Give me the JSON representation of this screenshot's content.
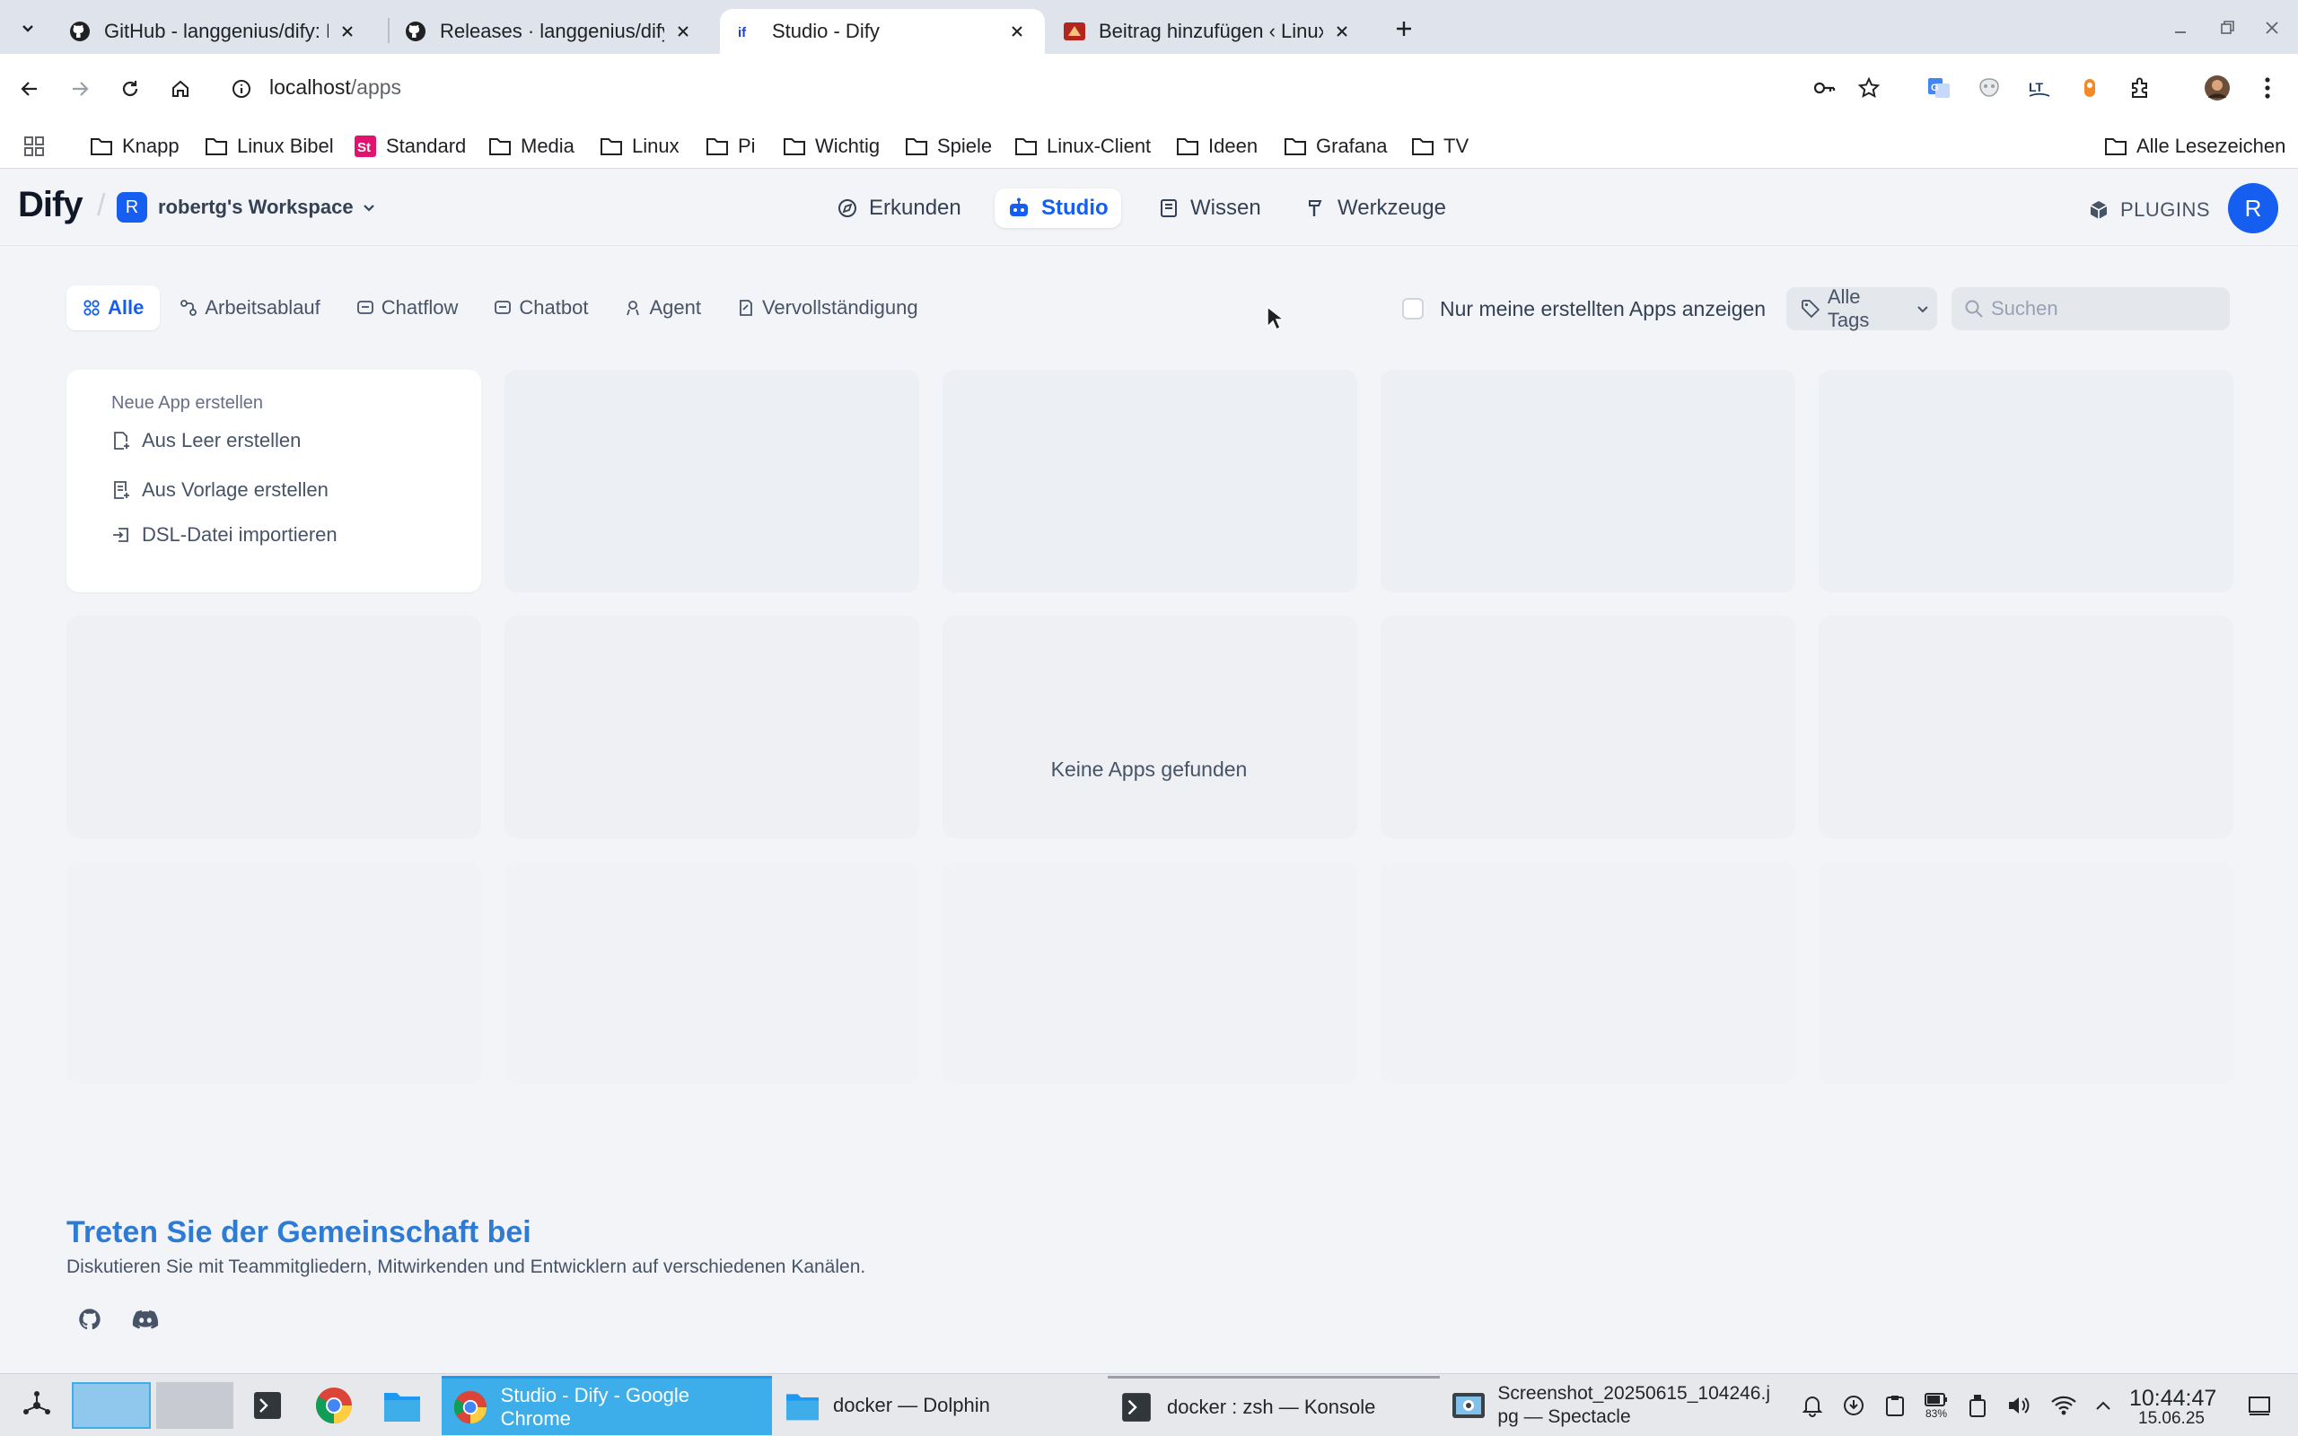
{
  "browser": {
    "tabs": [
      {
        "title": "GitHub - langgenius/dify: Pr"
      },
      {
        "title": "Releases · langgenius/dify"
      },
      {
        "title": "Studio - Dify"
      },
      {
        "title": "Beitrag hinzufügen ‹ Linux-"
      }
    ],
    "url_host": "localhost",
    "url_path": "/apps",
    "bookmarks": [
      "Knapp",
      "Linux Bibel",
      "Standard",
      "Media",
      "Linux",
      "Pi",
      "Wichtig",
      "Spiele",
      "Linux-Client",
      "Ideen",
      "Grafana",
      "TV"
    ],
    "all_bookmarks": "Alle Lesezeichen"
  },
  "app": {
    "logo": "Dify",
    "workspace_initial": "R",
    "workspace_name": "robertg's Workspace",
    "nav": [
      {
        "label": "Erkunden"
      },
      {
        "label": "Studio"
      },
      {
        "label": "Wissen"
      },
      {
        "label": "Werkzeuge"
      }
    ],
    "plugins_label": "PLUGINS",
    "avatar_initial": "R",
    "filters": [
      "Alle",
      "Arbeitsablauf",
      "Chatflow",
      "Chatbot",
      "Agent",
      "Vervollständigung"
    ],
    "only_mine_label": "Nur meine erstellten Apps anzeigen",
    "tags_label": "Alle Tags",
    "search_placeholder": "Suchen",
    "create_card": {
      "title": "Neue App erstellen",
      "items": [
        "Aus Leer erstellen",
        "Aus Vorlage erstellen",
        "DSL-Datei importieren"
      ]
    },
    "empty_message": "Keine Apps gefunden",
    "footer": {
      "title": "Treten Sie der Gemeinschaft bei",
      "subtitle": "Diskutieren Sie mit Teammitgliedern, Mitwirkenden und Entwicklern auf verschiedenen Kanälen."
    }
  },
  "taskbar": {
    "tasks": [
      {
        "label": "Studio - Dify - Google Chrome"
      },
      {
        "label": "docker — Dolphin"
      },
      {
        "label": "docker : zsh — Konsole"
      },
      {
        "label_line1": "Screenshot_20250615_104246.j",
        "label_line2": "pg — Spectacle"
      }
    ],
    "battery": "83%",
    "time": "10:44:47",
    "date": "15.06.25"
  },
  "colors": {
    "accent": "#155eef",
    "community_title": "#2e7bd6",
    "taskbar_active": "#3daee9"
  }
}
